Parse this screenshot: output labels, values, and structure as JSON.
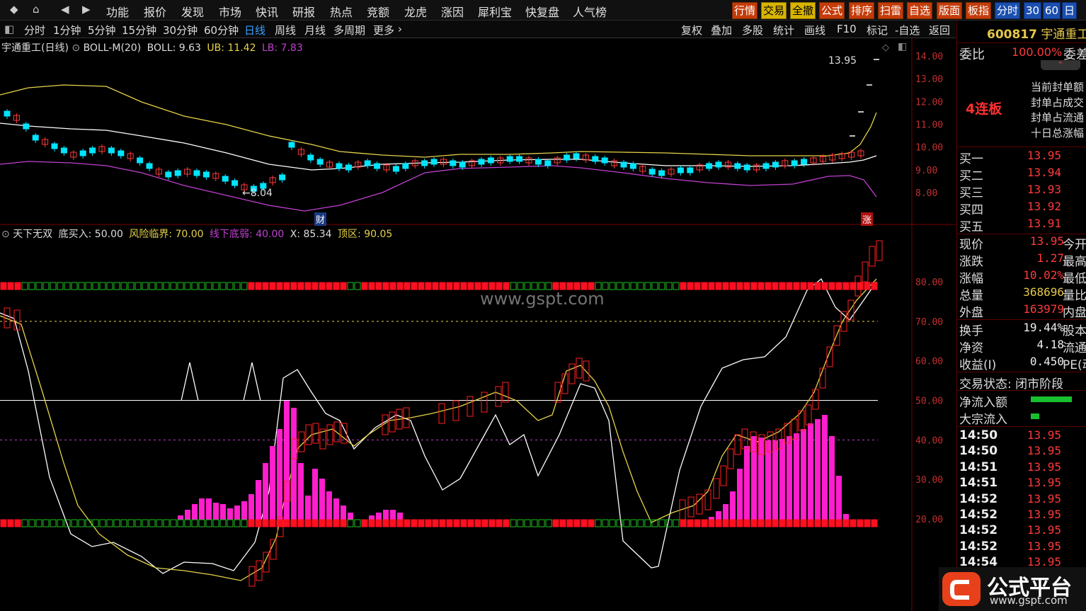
{
  "topmenu": {
    "icons": [
      "diamond-icon",
      "home-icon",
      "back-icon",
      "forward-icon"
    ],
    "nav_items": [
      "功能",
      "报价",
      "发现",
      "市场",
      "快讯",
      "研报",
      "热点",
      "竞额",
      "龙虎",
      "涨因",
      "犀利宝",
      "快复盘",
      "人气榜"
    ],
    "right_buttons": [
      "行情",
      "交易",
      "全撤",
      "公式",
      "排序",
      "扫雷",
      "自选",
      "版面",
      "板指",
      "分时",
      "30",
      "60",
      "日"
    ]
  },
  "periodbar": {
    "periods": [
      "分时",
      "1分钟",
      "5分钟",
      "15分钟",
      "30分钟",
      "60分钟",
      "日线",
      "周线",
      "月线",
      "多周期",
      "更多"
    ],
    "selected": "日线",
    "tools": [
      "复权",
      "叠加",
      "多股",
      "统计",
      "画线",
      "F10",
      "标记",
      "-自选",
      "返回"
    ]
  },
  "main_info": {
    "title": "宇通重工(日线)",
    "indicator": "BOLL-M(20)",
    "boll": "BOLL: 9.63",
    "ub": "UB: 11.42",
    "lb": "LB: 7.83",
    "high_label": "13.95",
    "low_label": "8.04",
    "cai_badge": "财",
    "zhang_badge": "涨"
  },
  "sub_info": {
    "name": "天下无双",
    "buy": "底买入: 50.00",
    "risk": "风险临界: 70.00",
    "weak": "线下底弱: 40.00",
    "x": "X: 85.34",
    "top": "顶区: 90.05"
  },
  "watermark": "www.gspt.com",
  "price_axis": [
    "14.00",
    "13.00",
    "12.00",
    "11.00",
    "10.00",
    "9.00",
    "8.00"
  ],
  "sub_axis": [
    "80.00",
    "70.00",
    "60.00",
    "50.00",
    "40.00",
    "30.00",
    "20.00"
  ],
  "rpanel": {
    "code": "600817",
    "name": "宇通重工",
    "weibi_label": "委比",
    "weibi_value": "100.00%",
    "weicha": "委差",
    "lianban": "4连板",
    "seal_labels": [
      "当前封单额",
      "封单占成交",
      "封单占流通",
      "十日总涨幅"
    ],
    "bids": [
      {
        "label": "买一",
        "price": "13.95"
      },
      {
        "label": "买二",
        "price": "13.94"
      },
      {
        "label": "买三",
        "price": "13.93"
      },
      {
        "label": "买四",
        "price": "13.92"
      },
      {
        "label": "买五",
        "price": "13.91"
      }
    ],
    "stats": [
      {
        "label": "现价",
        "value": "13.95",
        "tail": "今开"
      },
      {
        "label": "涨跌",
        "value": "1.27",
        "tail": "最高"
      },
      {
        "label": "涨幅",
        "value": "10.02%",
        "tail": "最低"
      },
      {
        "label": "总量",
        "value": "368696",
        "tail": "量比"
      },
      {
        "label": "外盘",
        "value": "163979",
        "tail": "内盘"
      },
      {
        "label": "换手",
        "value": "19.44%",
        "tail": "股本"
      },
      {
        "label": "净资",
        "value": "4.18",
        "tail": "流通"
      },
      {
        "label": "收益(Ⅰ)",
        "value": "0.450",
        "tail": "PE(动"
      }
    ],
    "trade_status": "交易状态: 闭市阶段",
    "net_inflow": "净流入额",
    "block_inflow": "大宗流入",
    "ticks": [
      {
        "time": "14:50",
        "price": "13.95"
      },
      {
        "time": "14:50",
        "price": "13.95"
      },
      {
        "time": "14:51",
        "price": "13.95"
      },
      {
        "time": "14:51",
        "price": "13.95"
      },
      {
        "time": "14:52",
        "price": "13.95"
      },
      {
        "time": "14:52",
        "price": "13.95"
      },
      {
        "time": "14:52",
        "price": "13.95"
      },
      {
        "time": "14:52",
        "price": "13.95"
      },
      {
        "time": "14:54",
        "price": "13.95"
      }
    ]
  },
  "logo": {
    "title": "公式平台",
    "url": "www.gspt.com"
  },
  "colors": {
    "up": "#ff3a3a",
    "down": "#00e5ff",
    "boll_mid": "#ffffff",
    "boll_up": "#e6d24a",
    "boll_low": "#c040d0",
    "bar": "#ff1ecc"
  }
}
